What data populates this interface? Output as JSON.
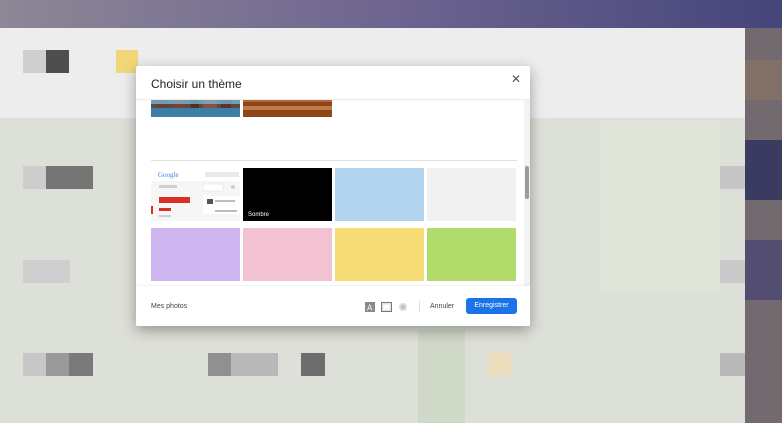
{
  "dialog": {
    "title": "Choisir un thème",
    "close_icon": "close-icon"
  },
  "themes": [
    {
      "id": "landscape-city",
      "color": "#2f4d5c"
    },
    {
      "id": "landscape-desert",
      "color": "#9c4f22"
    },
    {
      "id": "classic",
      "color": "#f2f2f2"
    },
    {
      "id": "dark",
      "label": "Sombre",
      "color": "#000000"
    },
    {
      "id": "light-blue",
      "color": "#b3d4ee"
    },
    {
      "id": "light-gray",
      "color": "#f1f1f1"
    },
    {
      "id": "lavender",
      "color": "#cdb5ef"
    },
    {
      "id": "pink",
      "color": "#f3c2d2"
    },
    {
      "id": "yellow",
      "color": "#f6dd75"
    },
    {
      "id": "green",
      "color": "#b1dc6c"
    },
    {
      "id": "mint",
      "color": "#d7ede2"
    },
    {
      "id": "floral-pink",
      "color": "#fbe3ea"
    },
    {
      "id": "turquoise",
      "color": "#92d9dc"
    },
    {
      "id": "navy",
      "color": "#4f628f"
    }
  ],
  "footer": {
    "my_photos": "Mes photos",
    "text_bg_icon": "text-background-icon",
    "vignette_icon": "vignette-icon",
    "blur_icon": "blur-icon",
    "cancel": "Annuler",
    "save": "Enregistrer"
  },
  "colors": {
    "accent": "#1a73e8"
  }
}
